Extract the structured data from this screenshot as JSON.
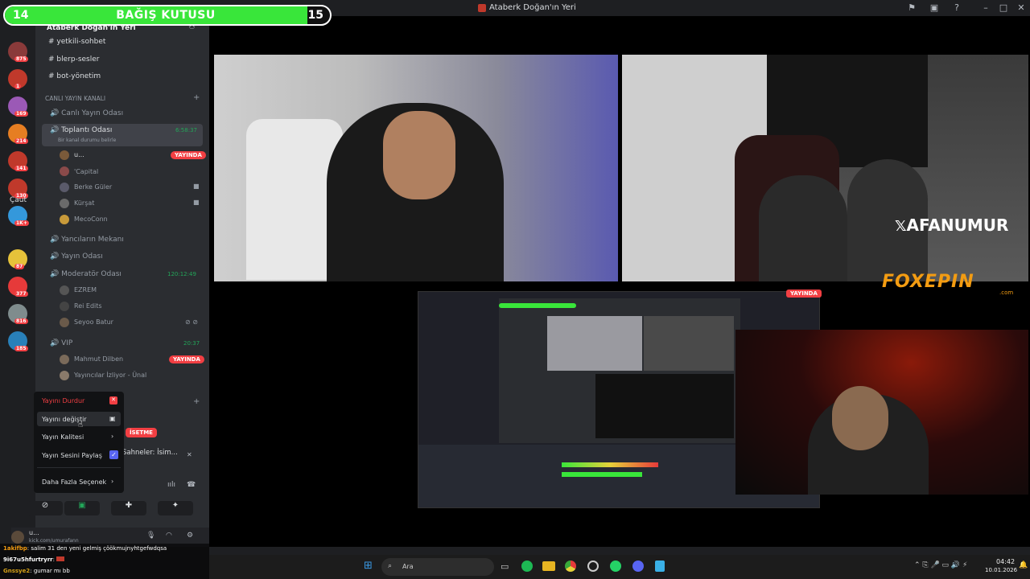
{
  "window": {
    "title": "Ataberk Doğan'ın Yeri"
  },
  "donation": {
    "left": "14",
    "title": "BAĞIŞ KUTUSU",
    "right": "15",
    "progress": 0.93
  },
  "server": {
    "name": "Ataberk Doğan'ın Yeri"
  },
  "rail": {
    "badges": [
      "875",
      "1",
      "169",
      "214",
      "141",
      "130",
      "1K+",
      "87",
      "377",
      "816",
      "185"
    ],
    "label": "Çaüt"
  },
  "channels": {
    "text": [
      "yetkili-sohbet",
      "blerp-sesler",
      "bot-yönetim"
    ],
    "category": "CANLI YAYIN KANALI",
    "voice": [
      {
        "name": "Canlı Yayın Odası"
      },
      {
        "name": "Toplantı Odası",
        "timer": "6:58:37",
        "status": "Bir kanal durumu belirle"
      }
    ],
    "meeting_users": [
      {
        "name": "u...",
        "live": "YAYINDA"
      },
      {
        "name": "'Capital"
      },
      {
        "name": "Berke Güler"
      },
      {
        "name": "Kürşat"
      },
      {
        "name": "MecoConn"
      }
    ],
    "more": [
      {
        "name": "Yancıların Mekanı"
      },
      {
        "name": "Yayın Odası"
      },
      {
        "name": "Moderatör Odası",
        "timer": "120:12:49"
      }
    ],
    "mod_users": [
      "EZREM",
      "Rei Edits",
      "Seyoo Batur"
    ],
    "vip": {
      "name": "VIP",
      "timer": "20:37"
    },
    "vip_users": [
      {
        "name": "Mahmut Dilben",
        "live": "YAYINDA"
      },
      {
        "name": "Yayıncılar İzliyor - Ünal"
      }
    ]
  },
  "context_menu": {
    "items": [
      "Yayını Durdur",
      "Yayını değiştir",
      "Yayın Kalitesi",
      "Yayın Sesini Paylaş",
      "Daha Fazla Seçenek"
    ]
  },
  "voice_panel": {
    "stop_label": "İSETME",
    "scene_text": "Sahneler: İsim...",
    "user_name": "u...",
    "user_status": "kick.com/umurafann"
  },
  "chat": [
    {
      "user": "1akifbp",
      "text": "salim 31 den yeni gelmiş çöökmujnyhtgefwdqsa"
    },
    {
      "user": "9i67u5hfurtryrr",
      "text": ""
    },
    {
      "user": "Gnssye2",
      "text": "gumar mı bb"
    }
  ],
  "overlay": {
    "handle": "AFANUMUR",
    "sponsor": "FOXEPIN",
    "sponsor_sub": ".com",
    "live_badge": "YAYINDA"
  },
  "taskbar": {
    "search": "Ara",
    "time": "04:42",
    "date": "10.01.2026"
  },
  "colors": {
    "accent_green": "#39e63a",
    "live_red": "#f23f43",
    "bg": "#1e1f22",
    "sidebar": "#2b2d31"
  }
}
